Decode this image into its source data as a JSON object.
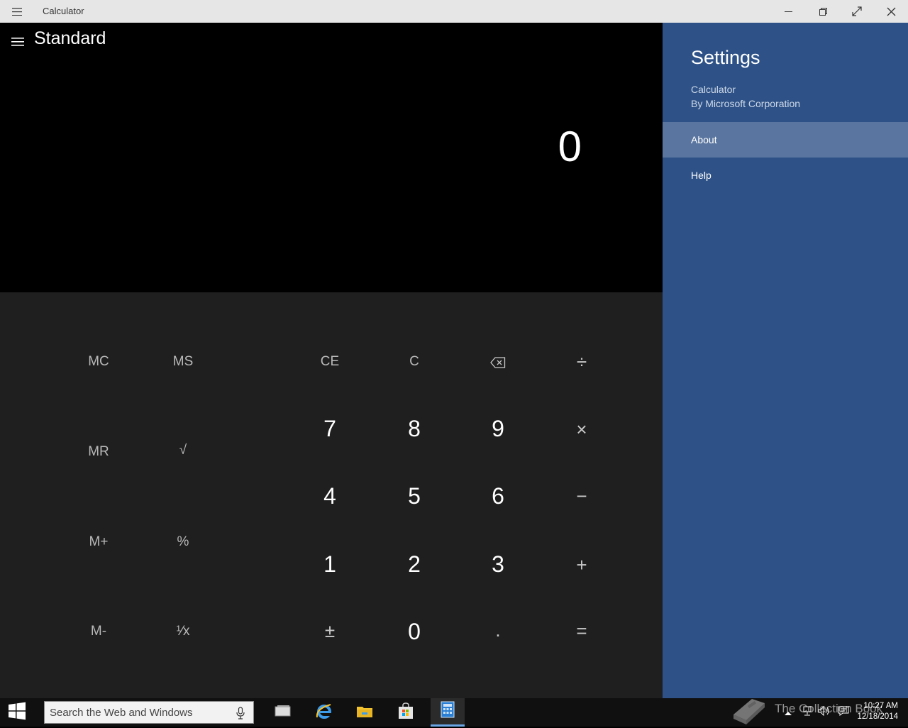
{
  "window": {
    "title": "Calculator"
  },
  "calculator": {
    "mode_title": "Standard",
    "display_value": "0",
    "memory_keys": {
      "mc": "MC",
      "ms": "MS",
      "mr": "MR",
      "sqrt": "√",
      "mplus": "M+",
      "percent": "%",
      "mminus": "M-",
      "reciprocal": "¹⁄x"
    },
    "control_keys": {
      "ce": "CE",
      "c": "C",
      "backspace": "⌫"
    },
    "operators": {
      "divide": "÷",
      "multiply": "×",
      "subtract": "−",
      "add": "+",
      "equals": "="
    },
    "digits": {
      "d7": "7",
      "d8": "8",
      "d9": "9",
      "d4": "4",
      "d5": "5",
      "d6": "6",
      "d1": "1",
      "d2": "2",
      "d3": "3",
      "d0": "0",
      "negate": "±",
      "decimal": "."
    }
  },
  "settings": {
    "title": "Settings",
    "app_name": "Calculator",
    "publisher": "By Microsoft Corporation",
    "items": [
      {
        "label": "About",
        "active": true
      },
      {
        "label": "Help",
        "active": false
      }
    ]
  },
  "taskbar": {
    "search_placeholder": "Search the Web and Windows",
    "apps": [
      "task-view",
      "internet-explorer",
      "file-explorer",
      "store",
      "calculator"
    ],
    "clock_time": "10:27 AM",
    "clock_date": "12/18/2014"
  },
  "watermark": {
    "text": "The Collection Book"
  },
  "colors": {
    "settings_bg": "#2e5287",
    "settings_active": "#5a76a0",
    "keypad_bg": "#1f1f1f",
    "display_bg": "#000000",
    "titlebar_bg": "#e6e6e6"
  }
}
